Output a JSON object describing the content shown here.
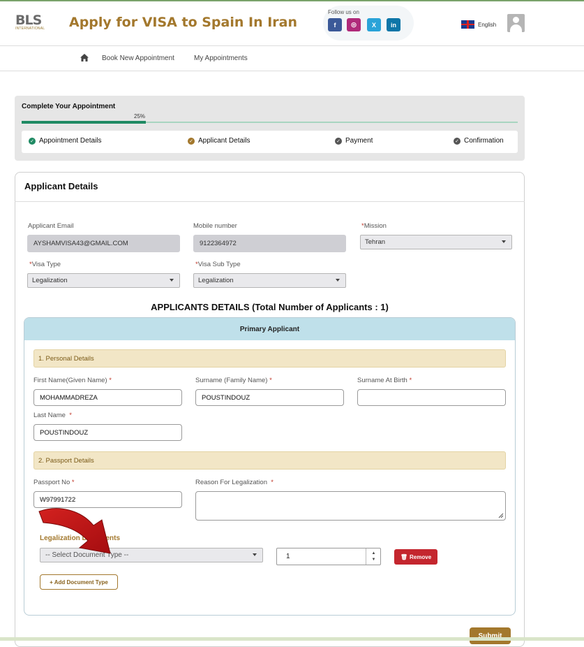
{
  "header": {
    "logo_text": "BLS",
    "logo_subtext": "INTERNATIONAL",
    "title": "Apply for VISA to Spain In Iran",
    "follow_label": "Follow us on",
    "social": [
      {
        "icon": "facebook-icon",
        "glyph": "f",
        "color": "#3b5998"
      },
      {
        "icon": "instagram-icon",
        "glyph": "◎",
        "color": "#b02a7a"
      },
      {
        "icon": "x-twitter-icon",
        "glyph": "X",
        "color": "#1da1f2"
      },
      {
        "icon": "linkedin-icon",
        "glyph": "in",
        "color": "#0e76a8"
      }
    ],
    "language": "English"
  },
  "nav": {
    "items": [
      "Book New Appointment",
      "My Appointments"
    ]
  },
  "progress": {
    "title": "Complete Your Appointment",
    "percent_label": "25%",
    "percent": 25,
    "steps": [
      {
        "label": "Appointment Details",
        "color": "#1f8a63"
      },
      {
        "label": "Applicant Details",
        "color": "#a3782d"
      },
      {
        "label": "Payment",
        "color": "#555555"
      },
      {
        "label": "Confirmation",
        "color": "#555555"
      }
    ]
  },
  "form": {
    "title": "Applicant Details",
    "email_label": "Applicant Email",
    "email_value": "AYSHAMVISA43@GMAIL.COM",
    "mobile_label": "Mobile number",
    "mobile_value": "9122364972",
    "mission_label": "Mission",
    "mission_value": "Tehran",
    "visa_type_label": "Visa Type",
    "visa_type_value": "Legalization",
    "visa_sub_type_label": "Visa Sub Type",
    "visa_sub_type_value": "Legalization",
    "applicants_heading": "APPLICANTS DETAILS (Total Number of Applicants : 1)",
    "primary_label": "Primary Applicant",
    "personal_section": "1. Personal Details",
    "first_name_label": "First Name(Given Name)",
    "first_name_value": "MOHAMMADREZA",
    "surname_label": "Surname (Family Name)",
    "surname_value": "POUSTINDOUZ",
    "surname_birth_label": "Surname At Birth",
    "surname_birth_value": "",
    "last_name_label": "Last Name",
    "last_name_value": "POUSTINDOUZ",
    "passport_section": "2. Passport Details",
    "passport_label": "Passport No",
    "passport_value": "W97991722",
    "reason_label": "Reason For Legalization",
    "legal_docs_label": "Legalization Documents",
    "doc_type_placeholder": "-- Select Document Type --",
    "doc_count": "1",
    "remove_label": "Remove",
    "add_doc_label": "+ Add Document Type",
    "submit_label": "Submit",
    "required_mark": "*"
  }
}
